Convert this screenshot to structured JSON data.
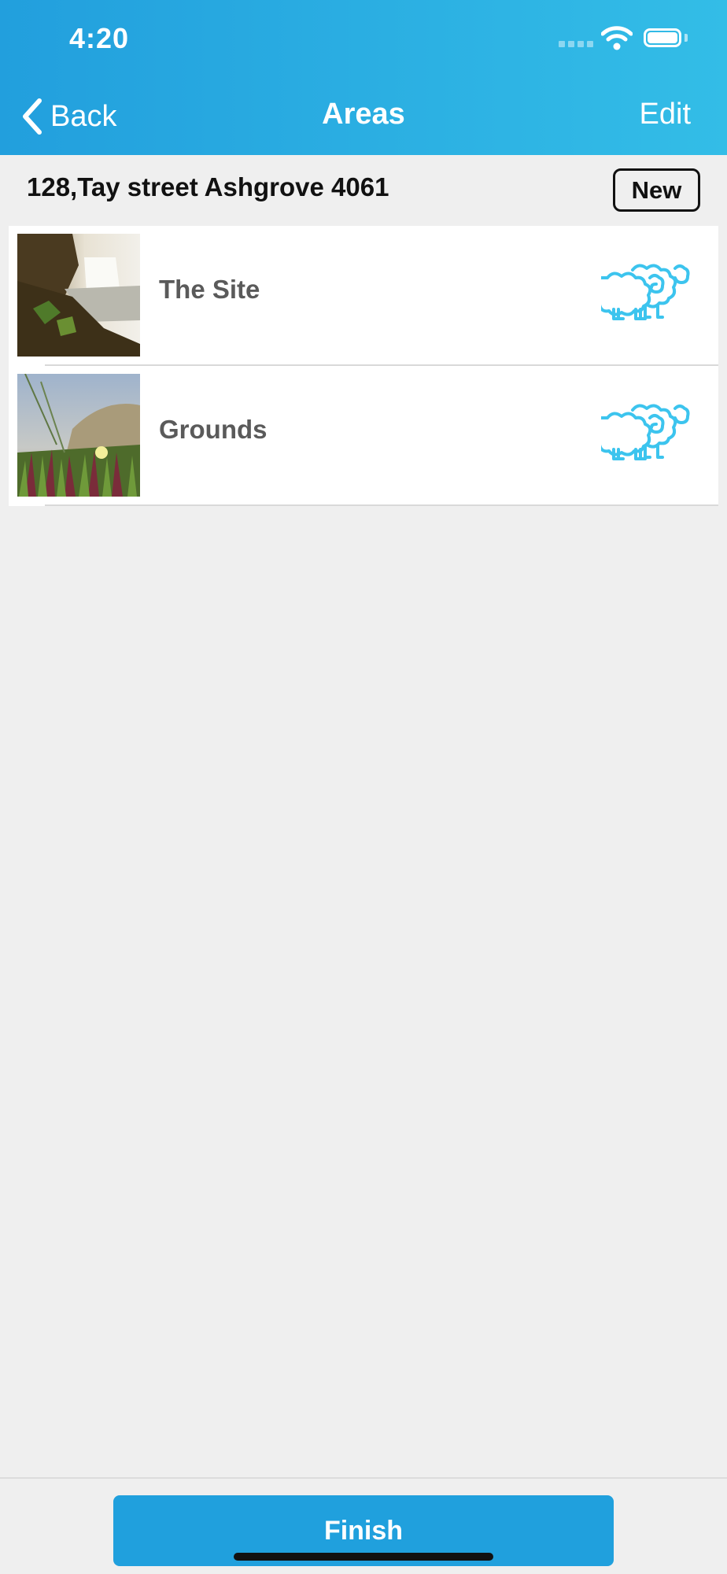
{
  "status_bar": {
    "time": "4:20"
  },
  "nav": {
    "back_label": "Back",
    "title": "Areas",
    "edit_label": "Edit"
  },
  "address": {
    "text": "128,Tay street Ashgrove 4061",
    "new_label": "New"
  },
  "areas": [
    {
      "label": "The Site",
      "thumbnail": "waterfall-photo",
      "icon": "sheep-icon"
    },
    {
      "label": "Grounds",
      "thumbnail": "flower-grass-photo",
      "icon": "sheep-icon"
    }
  ],
  "footer": {
    "finish_label": "Finish"
  },
  "colors": {
    "header_start": "#229fdd",
    "header_end": "#33bde7",
    "accent": "#20a0dd",
    "sheep": "#3cc4ee"
  }
}
